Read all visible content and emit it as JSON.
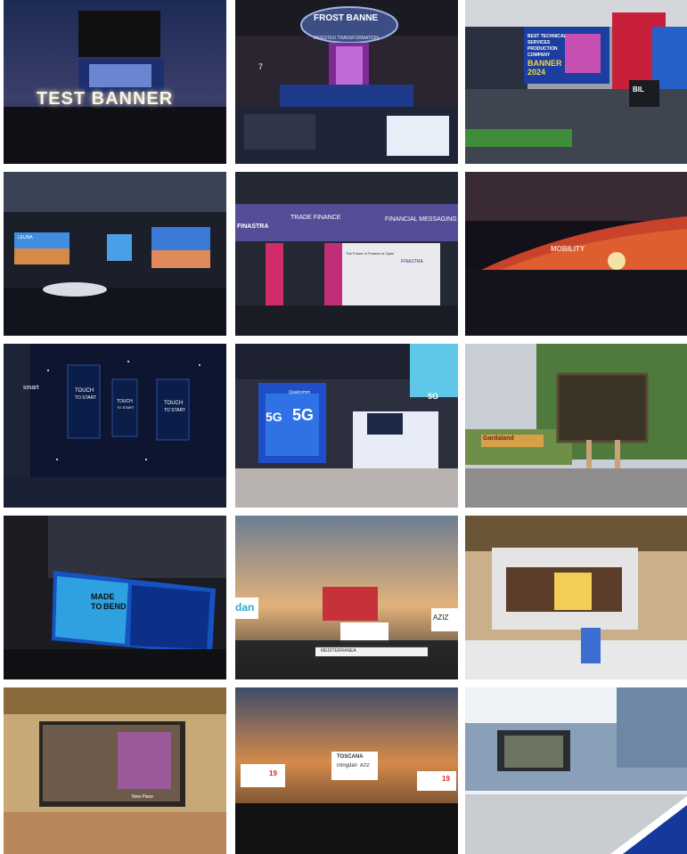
{
  "gallery": {
    "tiles": [
      {
        "texts": {
          "banner": "TEST BANNER"
        }
      },
      {
        "texts": {
          "ring_top": "FROST BANNE",
          "ring_bottom": "INVESTED TRANSFORMATION",
          "pillar": "7"
        }
      },
      {
        "texts": {
          "screen_l1": "BEST TECHNICAL",
          "screen_l2": "SERVICES",
          "screen_l3": "PRODUCTION",
          "screen_l4": "COMPANY",
          "screen_l5": "BANNER",
          "screen_l6": "2024",
          "sign": "BIL"
        }
      },
      {
        "texts": {
          "screen": "LEUNA"
        }
      },
      {
        "texts": {
          "header_left": "FINASTRA",
          "header_mid": "TRADE FINANCE",
          "header_right": "FINANCIAL MESSAGING",
          "panel_title": "The Future of Finance is Open",
          "panel_logo": "FINASTRA"
        }
      },
      {
        "texts": {
          "screen": "MOBILITY"
        }
      },
      {
        "texts": {
          "brand": "smart",
          "screen1_l1": "TOUCH",
          "screen1_l2": "TO START",
          "screen2_l1": "TOUCH",
          "screen2_l2": "TO START",
          "screen3_l1": "TOUCH",
          "screen3_l2": "TO START"
        }
      },
      {
        "texts": {
          "cube_a": "5G",
          "cube_b": "5G",
          "sign": "5G",
          "brand": "Qualcomm"
        }
      },
      {
        "texts": {
          "sign": "Gardaland"
        }
      },
      {
        "texts": {
          "ad_line1": "MADE",
          "ad_line2": "TO",
          "ad_line3": "BEND"
        }
      },
      {
        "texts": {
          "left_edge": "dan",
          "right_edge": "AZIZ",
          "banner": "MEDITERRANEA"
        }
      },
      {
        "texts": {}
      },
      {
        "texts": {
          "ad": "New Place"
        }
      },
      {
        "texts": {
          "left_sign_num": "19",
          "right_sign_num": "19",
          "mid_sign_top": "TOSCANA",
          "mid_sign_mid": "mingdan",
          "mid_sign_bot": "AZIZ"
        }
      },
      {
        "texts": {}
      }
    ]
  },
  "colors": {
    "corner_blue": "#15389c",
    "corner_white": "#ffffff"
  }
}
